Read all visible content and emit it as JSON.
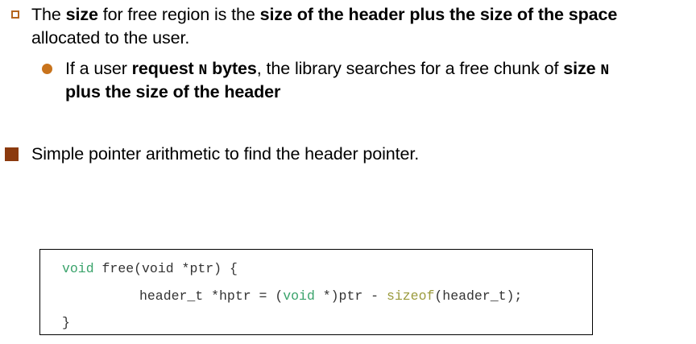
{
  "bullets": [
    {
      "level": 1,
      "marker": "hollow-square",
      "seg_1": "The ",
      "seg_2_bold": "size",
      "seg_3": " for free region is the ",
      "seg_4_bold": "size of the header plus the size of the space",
      "line2": "allocated to the user."
    },
    {
      "level": 2,
      "marker": "filled-circle",
      "seg_1": "If a user ",
      "seg_2_bold": "request ",
      "seg_3_mono": "N",
      "seg_4_bold": " bytes",
      "seg_5": ", the library searches for a free chunk of ",
      "seg_6_bold": "size ",
      "seg_7_mono": "N",
      "line2_bold": "plus the size of the header"
    },
    {
      "level": 1,
      "marker": "filled-square",
      "text": "Simple pointer arithmetic to find the header pointer."
    }
  ],
  "code": {
    "line1": {
      "kw1": "void",
      "rest1": " free(",
      "kw2": "void",
      "rest2": " *ptr) {"
    },
    "line2": {
      "plain1": "header_t *hptr = (",
      "kw": "void",
      "plain2": " *)ptr - ",
      "fn": "sizeof",
      "plain3": "(header_t);"
    },
    "line3": "}"
  },
  "colors": {
    "bullet_hollow_square": "#b5651d",
    "bullet_circle": "#c8731c",
    "bullet_filled_square": "#8b3a0e",
    "code_keyword": "#3aa36b",
    "code_sizeof": "#9a9a3c"
  }
}
